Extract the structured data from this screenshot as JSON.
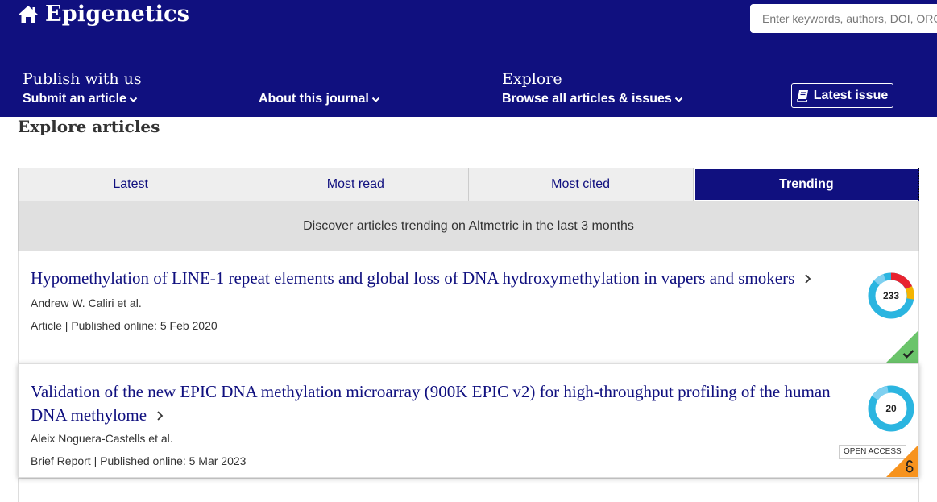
{
  "header": {
    "journal_title": "Epigenetics",
    "search_placeholder": "Enter keywords, authors, DOI, ORCID",
    "nav": {
      "publish_heading": "Publish with us",
      "submit_label": "Submit an article",
      "about_label": "About this journal",
      "explore_heading": "Explore",
      "browse_label": "Browse all articles & issues"
    },
    "latest_issue_label": "Latest issue",
    "brand_color": "#10107f"
  },
  "explore": {
    "title": "Explore articles",
    "tabs": [
      {
        "label": "Latest",
        "active": false
      },
      {
        "label": "Most read",
        "active": false
      },
      {
        "label": "Most cited",
        "active": false
      },
      {
        "label": "Trending",
        "active": true
      }
    ],
    "tab_description": "Discover articles trending on Altmetric in the last 3 months"
  },
  "articles": [
    {
      "title": "Hypomethylation of LINE-1 repeat elements and global loss of DNA hydroxymethylation in vapers and smokers",
      "authors": "Andrew W. Caliri et al.",
      "meta": "Article | Published online: 5 Feb 2020",
      "altmetric_score": "233",
      "access_icon": "check-icon",
      "access_color": "#6bc46b"
    },
    {
      "title": "Validation of the new EPIC DNA methylation microarray (900K EPIC v2) for high-throughput profiling of the human DNA methylome",
      "authors": "Aleix Noguera-Castells et al.",
      "meta": "Brief Report | Published online: 5 Mar 2023",
      "altmetric_score": "20",
      "badge": "OPEN ACCESS",
      "access_icon": "open-lock-icon",
      "access_color": "#f7931e"
    }
  ]
}
